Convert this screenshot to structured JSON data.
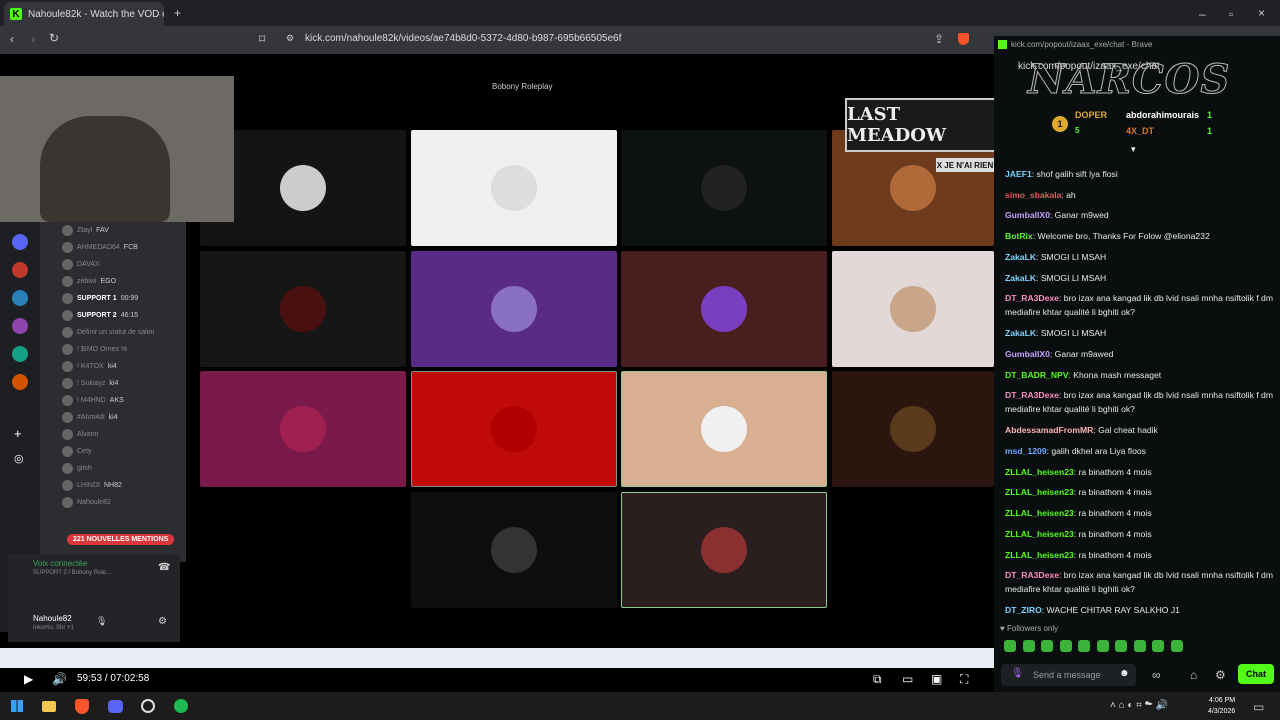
{
  "browser": {
    "tab_title": "Nahoule82k - Watch the VOD o",
    "url": "kick.com/nahoule82k/videos/ae74b8d0-5372-4d80-b987-695b66505e6f"
  },
  "video": {
    "game_title": "Bobony Roleplay",
    "overlay_title": "LAST MEADOW",
    "sticker_text": "X JE N'AI RIEN",
    "discord": {
      "voice_connected": "Voix connectée",
      "voice_channel": "SUPPORT 2 / Bobony Role...",
      "username": "Nahoule82",
      "status": "Inkomu, Shr +1",
      "mentions_badge": "221 NOUVELLES MENTIONS",
      "channels": [
        {
          "name": "Ztayl",
          "tag": "FAV"
        },
        {
          "name": "AHMEDAD64",
          "tag": "FCB"
        },
        {
          "name": "DAVAX",
          "tag": ""
        },
        {
          "name": "zebiwi",
          "tag": "EGO"
        },
        {
          "name": "SUPPORT 1",
          "tag": "00:99"
        },
        {
          "name": "SUPPORT 2",
          "tag": "46:15"
        },
        {
          "name": "Définir un statut de salon",
          "tag": ""
        },
        {
          "name": "! $IMO Ornes %",
          "tag": ""
        },
        {
          "name": "! K4TOX",
          "tag": "ki4"
        },
        {
          "name": "! Sukiayz",
          "tag": "ki4"
        },
        {
          "name": "! M4HND",
          "tag": "AKS"
        },
        {
          "name": "#Ahm4di",
          "tag": "ki4"
        },
        {
          "name": "Alvarin",
          "tag": ""
        },
        {
          "name": "Cety",
          "tag": ""
        },
        {
          "name": "gitsh",
          "tag": ""
        },
        {
          "name": "LHINDI",
          "tag": "NH82"
        },
        {
          "name": "Nahoule82",
          "tag": ""
        }
      ]
    }
  },
  "player": {
    "current_time": "59:53",
    "duration": "07:02:58"
  },
  "chat": {
    "window_title": "kick.com/popout/izaax_exe/chat - Brave",
    "url": "kick.com/popout/izaax_exe/chat",
    "leaderboard": [
      {
        "rank": "1",
        "name": "DOPER",
        "count": "5"
      },
      {
        "rank": "",
        "name": "abdorahimourais",
        "count": "1"
      },
      {
        "rank": "",
        "name": "4X_DT",
        "count": "1"
      }
    ],
    "messages": [
      {
        "user": "JAEF1",
        "color": "#7fd3ff",
        "text": "shof galih sift lya flosi"
      },
      {
        "user": "simo_sbakala",
        "color": "#e05a5a",
        "text": "ah"
      },
      {
        "user": "GumballX0",
        "color": "#c9a0ff",
        "text": "Ganar m9wed"
      },
      {
        "user": "BotRix",
        "color": "#53fc18",
        "text": "Welcome bro, Thanks For Folow @eliona232"
      },
      {
        "user": "ZakaLK",
        "color": "#7fd3ff",
        "text": "SMOGI LI MSAH"
      },
      {
        "user": "ZakaLK",
        "color": "#7fd3ff",
        "text": "SMOGI LI MSAH"
      },
      {
        "user": "DT_RA3Dexe",
        "color": "#ff8fbf",
        "text": "bro izax ana kangad lik db lvid nsali mnha nsiftolik f dm mediafire khtar qualité li bghiti ok?"
      },
      {
        "user": "ZakaLK",
        "color": "#7fd3ff",
        "text": "SMOGI LI MSAH"
      },
      {
        "user": "GumballX0",
        "color": "#c9a0ff",
        "text": "Ganar m9awed"
      },
      {
        "user": "DT_BADR_NPV",
        "color": "#53fc18",
        "text": "Khona mash messaget"
      },
      {
        "user": "DT_RA3Dexe",
        "color": "#ff8fbf",
        "text": "bro izax ana kangad lik db lvid nsali mnha nsiftolik f dm mediafire khtar qualité li bghiti ok?"
      },
      {
        "user": "AbdessamadFromMR",
        "color": "#ffb3b3",
        "text": "Gal cheat hadik"
      },
      {
        "user": "msd_1209",
        "color": "#6fa8ff",
        "text": "galih dkhel ara Liya floos"
      },
      {
        "user": "ZLLAL_heisen23",
        "color": "#53fc18",
        "text": "ra binathom 4 mois"
      },
      {
        "user": "ZLLAL_heisen23",
        "color": "#53fc18",
        "text": "ra binathom 4 mois"
      },
      {
        "user": "ZLLAL_heisen23",
        "color": "#53fc18",
        "text": "ra binathom 4 mois"
      },
      {
        "user": "ZLLAL_heisen23",
        "color": "#53fc18",
        "text": "ra binathom 4 mois"
      },
      {
        "user": "ZLLAL_heisen23",
        "color": "#53fc18",
        "text": "ra binathom 4 mois"
      },
      {
        "user": "DT_RA3Dexe",
        "color": "#ff8fbf",
        "text": "bro izax ana kangad lik db lvid nsali mnha nsiftolik f dm mediafire khtar qualité li bghiti ok?"
      },
      {
        "user": "DT_ZIRO",
        "color": "#7fd3ff",
        "text": "WACHE CHITAR RAY SALKHO J1"
      }
    ],
    "followers_only": "Followers only",
    "input_placeholder": "Send a message",
    "send_label": "Chat"
  },
  "taskbar": {
    "time": "4:06 PM",
    "date": "4/3/2026"
  }
}
